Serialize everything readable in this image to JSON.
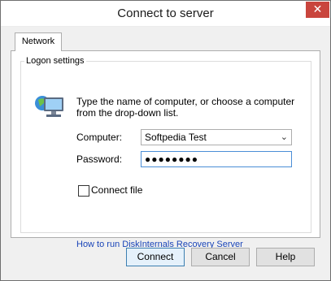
{
  "window": {
    "title": "Connect to server",
    "close_glyph": "✕"
  },
  "tabs": [
    {
      "label": "Network",
      "selected": true
    }
  ],
  "group": {
    "label": "Logon settings"
  },
  "instruction": "Type the name of computer, or choose a computer  from the drop-down list.",
  "computer": {
    "label": "Computer:",
    "value": "Softpedia Test",
    "arrow_icon": "chevron-down-icon"
  },
  "password": {
    "label": "Password:",
    "value": "●●●●●●●●"
  },
  "connect_file": {
    "label": "Connect file",
    "checked": false
  },
  "link": {
    "text": "How to run DiskInternals Recovery Server"
  },
  "buttons": {
    "connect": "Connect",
    "cancel": "Cancel",
    "help": "Help"
  },
  "colors": {
    "accent": "#3c7fb1",
    "link": "#1a45b8",
    "close": "#c9453d"
  }
}
